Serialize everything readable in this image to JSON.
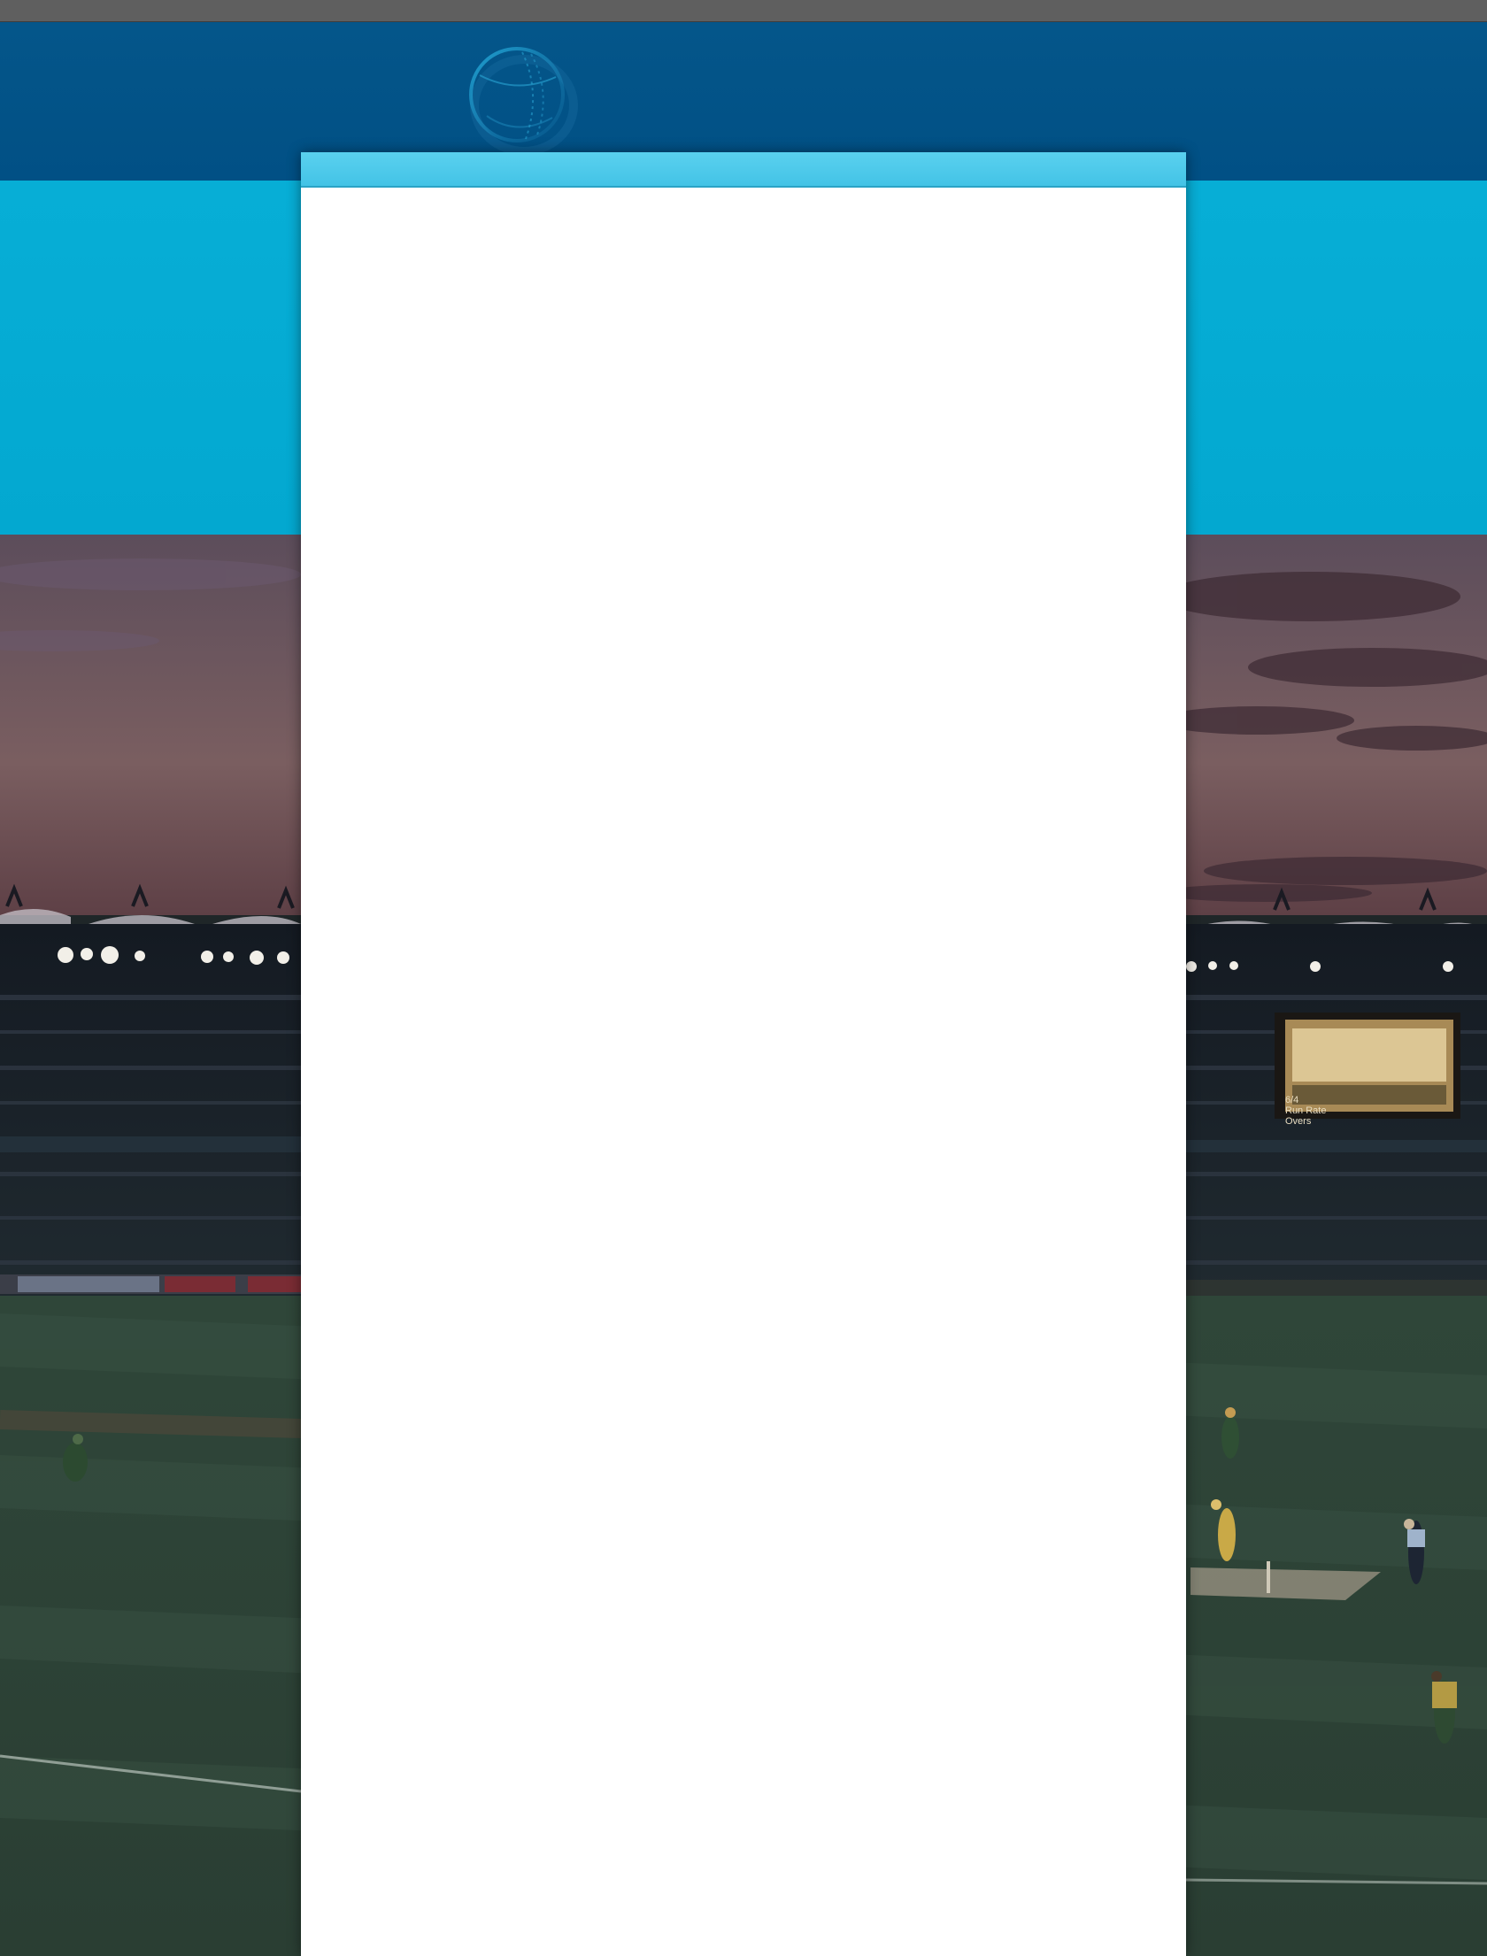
{
  "page": {
    "colors": {
      "top_strip": "#5f5f5f",
      "header_band": "#02528a",
      "accent_band": "#05acd4",
      "card_topbar": "#4ac8ea",
      "card_body": "#ffffff"
    }
  },
  "header": {
    "logo_icon": "cricket-ball-icon"
  },
  "background": {
    "image": "cricket-stadium-at-dusk",
    "scoreboard": {
      "lines": [
        "6/4",
        "Run Rate",
        "Overs"
      ]
    }
  },
  "content_card": {
    "state": "blank"
  }
}
